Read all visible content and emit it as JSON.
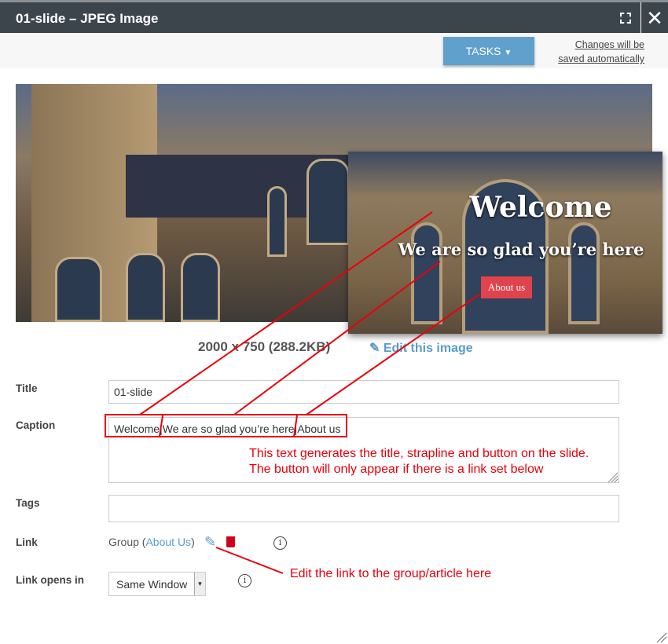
{
  "window": {
    "title": "01-slide – JPEG Image"
  },
  "toolbar": {
    "tasks_label": "TASKS",
    "save_note_1": "Changes will be",
    "save_note_2": "saved automatically"
  },
  "slide": {
    "title": "Welcome",
    "strapline": "We are so glad you’re here",
    "button": "About us"
  },
  "image": {
    "dimensions": "2000 x 750 (288.2KB)",
    "edit_label": "Edit this image"
  },
  "form": {
    "title_label": "Title",
    "title_value": "01-slide",
    "caption_label": "Caption",
    "caption_value": "Welcome|We are so glad you’re here|About us",
    "tags_label": "Tags",
    "tags_value": "",
    "link_label": "Link",
    "link_prefix": "Group (",
    "link_name": "About Us",
    "link_suffix": ")",
    "link_opens_label": "Link opens in",
    "link_opens_value": "Same Window"
  },
  "annotations": {
    "caption_note_1": "This text generates the title, strapline and button on the slide.",
    "caption_note_2": "The button will only appear if there is a link set below",
    "link_note": "Edit the link to the group/article here",
    "color": "#e8000b"
  },
  "colors": {
    "titlebar": "#3d454c",
    "accent": "#5fa0cc",
    "delete": "#d0021b"
  }
}
